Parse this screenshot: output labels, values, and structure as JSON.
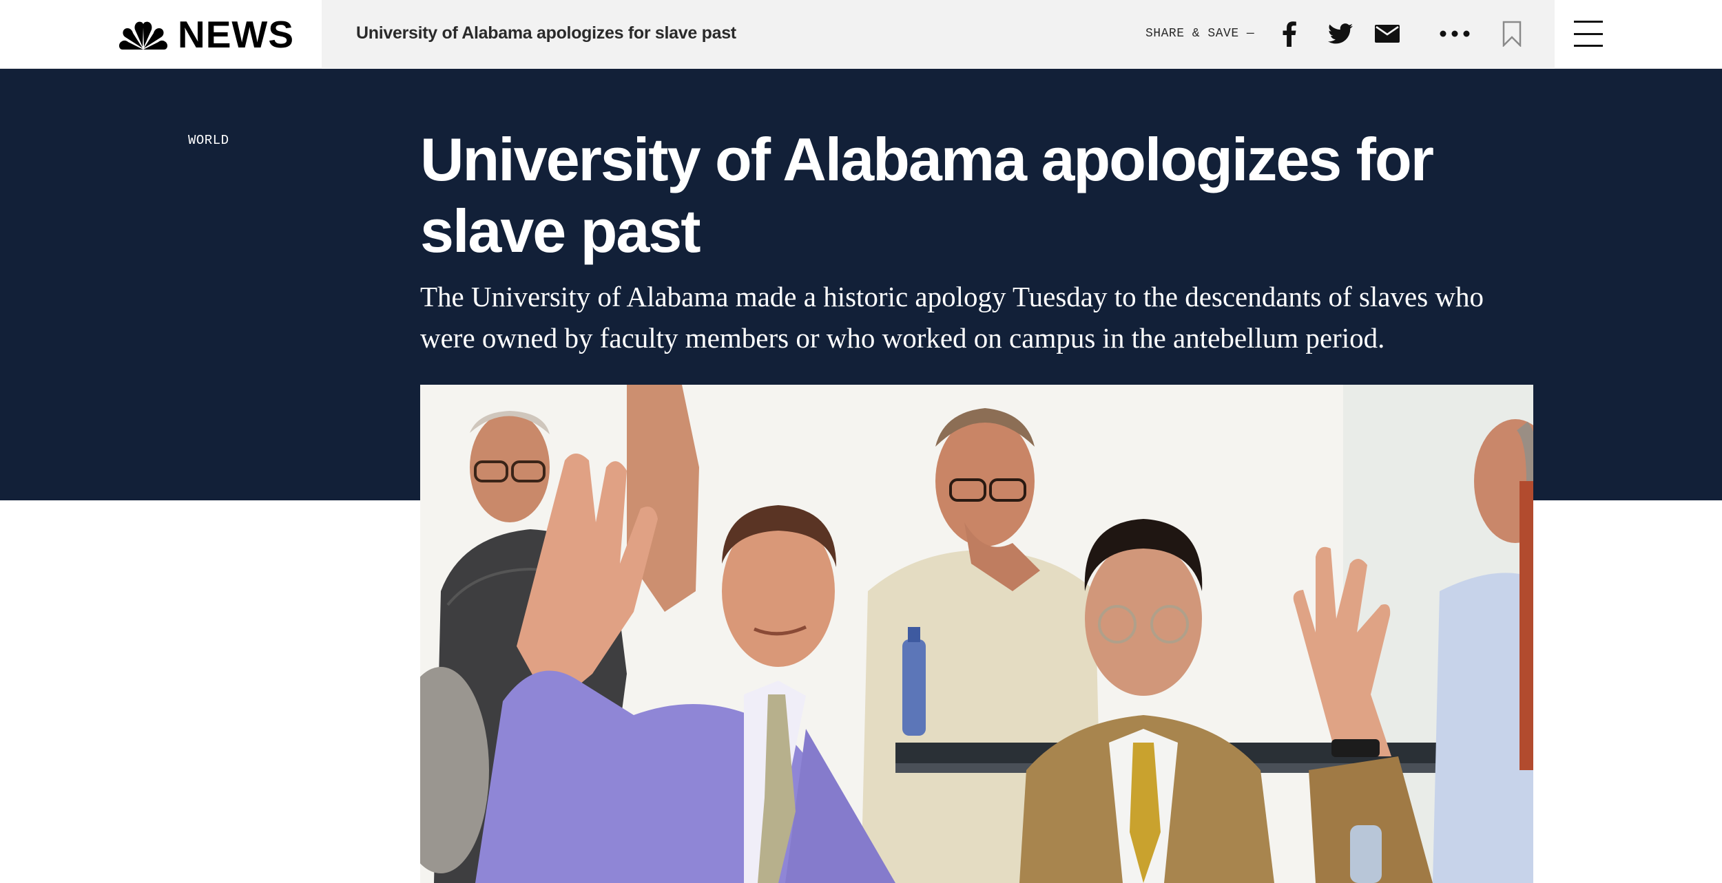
{
  "brand": {
    "logo_text": "NEWS",
    "logo_icon": "nbc-peacock-icon"
  },
  "article_bar": {
    "title": "University of Alabama apologizes for slave past",
    "share_label": "SHARE & SAVE —",
    "icons": [
      "facebook-icon",
      "twitter-icon",
      "mail-icon",
      "more-icon",
      "bookmark-icon"
    ]
  },
  "nav": {
    "menu_icon": "hamburger-menu-icon"
  },
  "article": {
    "section": "WORLD",
    "headline": "University of Alabama apologizes for slave past",
    "dek": "The University of Alabama made a historic apology Tuesday to the descendants of slaves who were owned by faculty members or who worked on campus in the antebellum period."
  },
  "colors": {
    "hero_background": "#122038",
    "article_bar_background": "#f2f2f2",
    "text_on_hero": "#ffffff"
  }
}
